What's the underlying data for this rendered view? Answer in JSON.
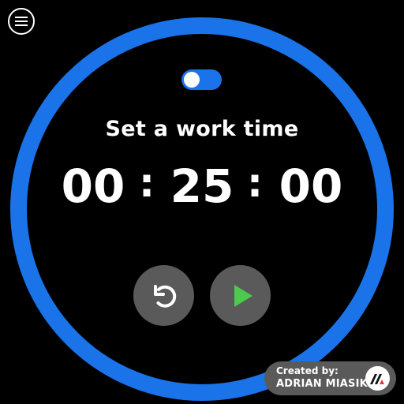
{
  "theme": {
    "accent": "#1a73e8",
    "play_green": "#4cc94f",
    "button_gray": "#5a5a5a",
    "logo_red": "#e53935"
  },
  "menu": {
    "icon": "menu-icon"
  },
  "mode_toggle": {
    "state": "off"
  },
  "heading": "Set a work time",
  "timer": {
    "hours": "00",
    "minutes": "25",
    "seconds": "00",
    "separator": ":"
  },
  "controls": {
    "reset_icon": "reset-icon",
    "play_icon": "play-icon"
  },
  "credit": {
    "label": "Created by:",
    "author": "ADRIAN MIASIK",
    "logo_icon": "author-logo-icon"
  }
}
